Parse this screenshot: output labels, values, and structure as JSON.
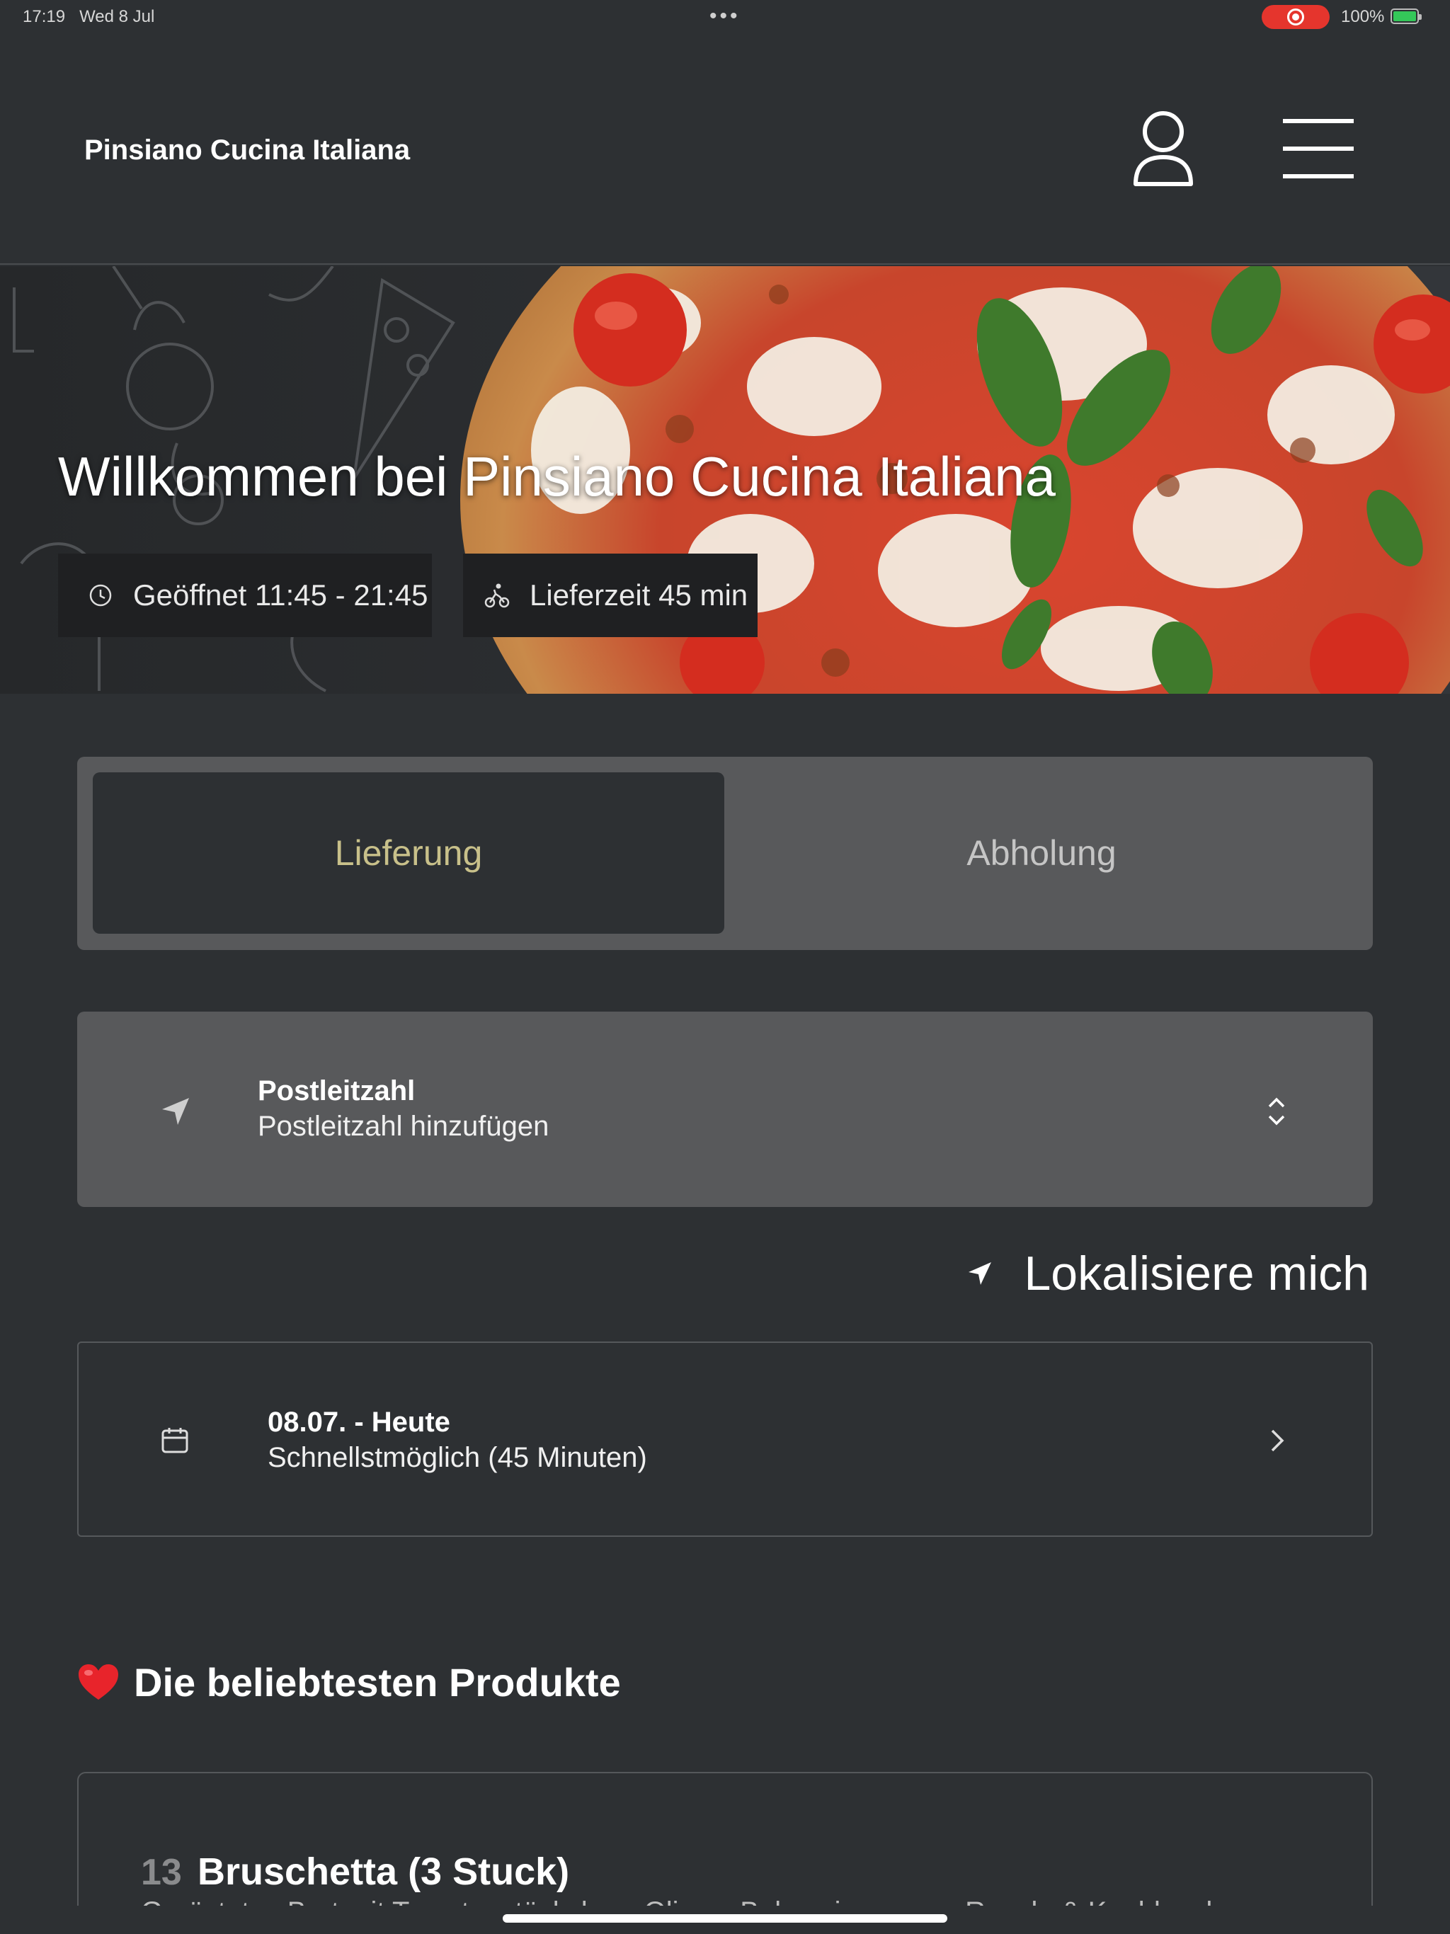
{
  "status_bar": {
    "time": "17:19",
    "date": "Wed 8 Jul",
    "dots": "•••",
    "battery": "100%"
  },
  "header": {
    "brand": "Pinsiano Cucina Italiana"
  },
  "hero": {
    "title": "Willkommen bei Pinsiano Cucina Italiana",
    "opening_hours": "Geöffnet 11:45 - 21:45",
    "delivery_time": "Lieferzeit 45 min"
  },
  "order_mode": {
    "delivery_label": "Lieferung",
    "pickup_label": "Abholung",
    "selected": "Lieferung"
  },
  "postal": {
    "label": "Postleitzahl",
    "placeholder": "Postleitzahl hinzufügen"
  },
  "locate": {
    "label": "Lokalisiere mich"
  },
  "schedule": {
    "date": "08.07. - Heute",
    "time": "Schnellstmöglich (45 Minuten)"
  },
  "popular": {
    "title": "Die beliebtesten Produkte",
    "products": [
      {
        "number": "13",
        "name": "Bruschetta (3 Stuck)",
        "description": "Geröstetes Brot mit Tomatenstückchen, Oliven, Balsamicocreme, Rucola & Knoblauch"
      }
    ]
  },
  "colors": {
    "background": "#2d3033",
    "panel": "#58595b",
    "accent": "#c8c08a"
  }
}
